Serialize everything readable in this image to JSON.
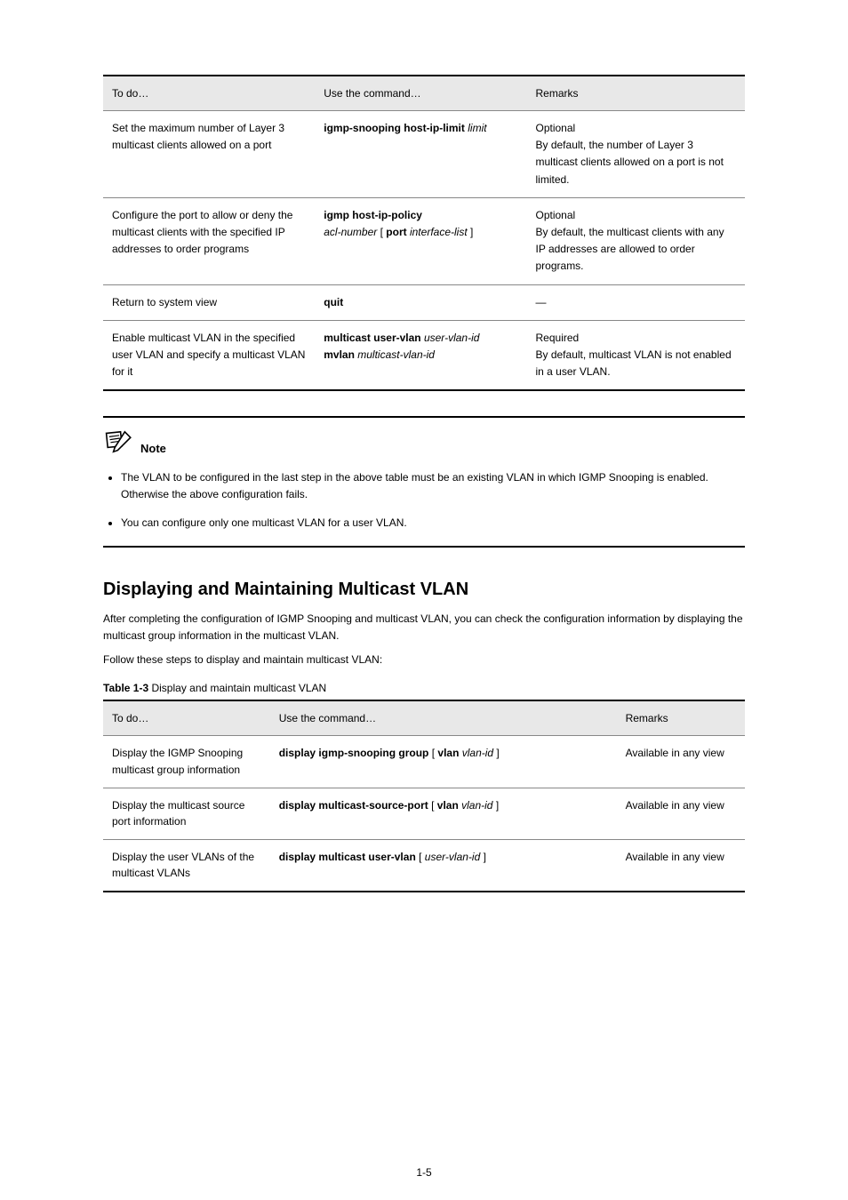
{
  "table1": {
    "headers": [
      "To do…",
      "Use the command…",
      "Remarks"
    ],
    "rows": [
      {
        "c1": "Set the maximum number of Layer 3 multicast clients allowed on a port",
        "c2_prefix": "igmp-snooping host-ip-limit ",
        "c2_arg": "limit",
        "c3": "Optional\nBy default, the number of Layer 3 multicast clients allowed on a port is not limited."
      },
      {
        "c1": "Configure the port to allow or deny the multicast clients with the specified IP addresses to order programs",
        "c2_a": "igmp host-ip-policy",
        "c2_b_arg": "acl-number",
        "c2_b_tail": " [ ",
        "c2_b_kw": "port interface-list",
        "c2_b_end": " ]",
        "c3": "Optional\nBy default, the multicast clients with any IP addresses are allowed to order programs."
      },
      {
        "c1": "Return to system view",
        "c2": "quit",
        "c3": "—"
      },
      {
        "c1": "Enable multicast VLAN in the specified user VLAN and specify a multicast VLAN for it",
        "c2_a": "multicast user-vlan",
        "c2_a_arg": " user-vlan-id",
        "c2_b": "mvlan ",
        "c2_b_arg": "multicast-vlan-id",
        "c3": "Required\nBy default, multicast VLAN is not enabled in a user VLAN."
      }
    ]
  },
  "note": {
    "label": "Note",
    "items": [
      "The VLAN to be configured in the last step in the above table must be an existing VLAN in which IGMP Snooping is enabled. Otherwise the above configuration fails.",
      "You can configure only one multicast VLAN for a user VLAN."
    ]
  },
  "section": {
    "heading": "Displaying and Maintaining Multicast VLAN",
    "para": "After completing the configuration of IGMP Snooping and multicast VLAN, you can check the configuration information by displaying the multicast group information in the multicast VLAN.",
    "follow": "Follow these steps to display and maintain multicast VLAN:",
    "caption": "Table 1-3 ",
    "captionTail": "Display and maintain multicast VLAN"
  },
  "table2": {
    "headers": [
      "To do…",
      "Use the command…",
      "Remarks"
    ],
    "rows": [
      {
        "c1": "Display the IGMP Snooping multicast group information",
        "c2_a": "display igmp-snooping group",
        "c2_b_open": " [ ",
        "c2_b_kw": "vlan",
        "c2_b_arg": " vlan-id",
        "c2_b_close": " ]",
        "c3": "Available in any view"
      },
      {
        "c1": "Display the multicast source port information",
        "c2_a": "display multicast-source-port",
        "c2_b_open": " [ ",
        "c2_b_kw": "vlan",
        "c2_b_arg": " vlan-id",
        "c2_b_close": " ]",
        "c3": "Available in any view"
      },
      {
        "c1": "Display the user VLANs of the multicast VLANs",
        "c2": "display multicast user-vlan",
        "c2_open": " [ ",
        "c2_arg": "user-vlan-id",
        "c2_close": " ]",
        "c3": "Available in any view"
      }
    ]
  },
  "pageNumber": "1-5"
}
